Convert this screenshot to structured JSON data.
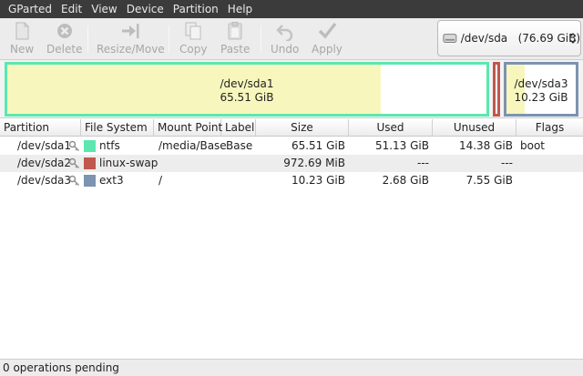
{
  "menubar": {
    "items": [
      "GParted",
      "Edit",
      "View",
      "Device",
      "Partition",
      "Help"
    ]
  },
  "toolbar": {
    "new_label": "New",
    "delete_label": "Delete",
    "resize_label": "Resize/Move",
    "copy_label": "Copy",
    "paste_label": "Paste",
    "undo_label": "Undo",
    "apply_label": "Apply",
    "device": "/dev/sda   (76.69 GiB)"
  },
  "diskmap": {
    "partitions": [
      {
        "name": "/dev/sda1",
        "size": "65.51 GiB",
        "used_fraction": 0.78,
        "border_color": "#5ce7b0"
      },
      {
        "name": "/dev/sda2",
        "size": "",
        "used_fraction": 0,
        "border_color": "#c0584e"
      },
      {
        "name": "/dev/sda3",
        "size": "10.23 GiB",
        "used_fraction": 0.26,
        "border_color": "#7d93b0"
      }
    ]
  },
  "table": {
    "headers": {
      "partition": "Partition",
      "filesystem": "File System",
      "mountpoint": "Mount Point",
      "label": "Label",
      "size": "Size",
      "used": "Used",
      "unused": "Unused",
      "flags": "Flags"
    },
    "rows": [
      {
        "partition": "/dev/sda1",
        "fs": "ntfs",
        "fs_color": "#5ce7b0",
        "mount": "/media/Base",
        "label": "Base",
        "size": "65.51 GiB",
        "used": "51.13 GiB",
        "unused": "14.38 GiB",
        "flags": "boot"
      },
      {
        "partition": "/dev/sda2",
        "fs": "linux-swap",
        "fs_color": "#c0584e",
        "mount": "",
        "label": "",
        "size": "972.69 MiB",
        "used": "---",
        "unused": "---",
        "flags": ""
      },
      {
        "partition": "/dev/sda3",
        "fs": "ext3",
        "fs_color": "#7d93b0",
        "mount": "/",
        "label": "",
        "size": "10.23 GiB",
        "used": "2.68 GiB",
        "unused": "7.55 GiB",
        "flags": ""
      }
    ]
  },
  "status": "0 operations pending"
}
